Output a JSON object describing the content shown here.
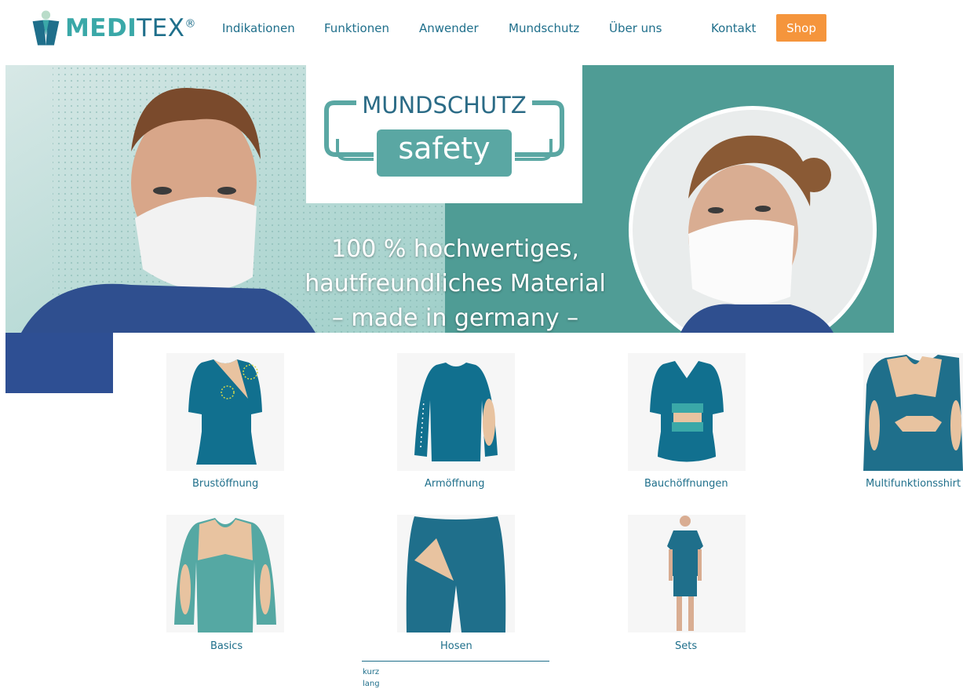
{
  "header": {
    "logo": {
      "text_part1": "MEDI",
      "text_part2": "TEX",
      "mark": "®",
      "icon": "meditex-figure-icon"
    },
    "nav": [
      {
        "label": "Indikationen"
      },
      {
        "label": "Funktionen"
      },
      {
        "label": "Anwender"
      },
      {
        "label": "Mundschutz"
      },
      {
        "label": "Über uns"
      },
      {
        "label": "Kontakt"
      }
    ],
    "shop_label": "Shop"
  },
  "hero": {
    "sign_top": "MUNDSCHUTZ",
    "sign_bottom": "safety",
    "text_line1": "100 % hochwertiges,",
    "text_line2": "hautfreundliches Material",
    "text_line3": "– made in germany –"
  },
  "categories": [
    {
      "label": "Brustöffnung",
      "icon": "shirt-chest-opening-icon"
    },
    {
      "label": "Armöffnung",
      "icon": "shirt-arm-opening-icon"
    },
    {
      "label": "Bauchöffnungen",
      "icon": "shirt-belly-opening-icon"
    },
    {
      "label": "Multifunktionsshirt",
      "icon": "multifunction-shirt-icon"
    },
    {
      "label": "Basics",
      "icon": "basic-shirt-icon"
    },
    {
      "label": "Hosen",
      "icon": "pants-icon"
    },
    {
      "label": "Sets",
      "icon": "person-set-icon"
    }
  ],
  "hosen_submenu": [
    {
      "label": "kurz"
    },
    {
      "label": "lang"
    }
  ],
  "colors": {
    "brand_dark": "#1f6f8b",
    "brand_teal": "#3aa8a8",
    "accent_orange": "#f5953c",
    "garment": "#11708f",
    "skin": "#e8c3a0"
  }
}
